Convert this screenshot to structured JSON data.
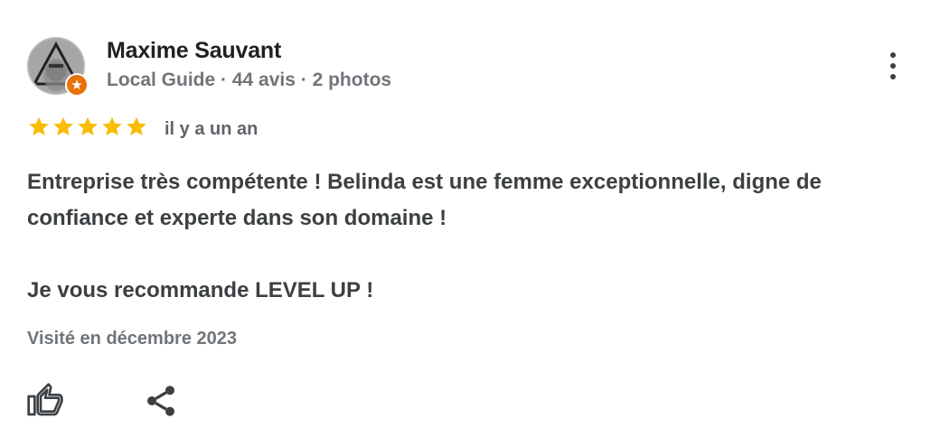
{
  "author": {
    "name": "Maxime Sauvant",
    "meta": "Local Guide · 44 avis · 2 photos",
    "avatar_icon": "user-photo-avatar",
    "badge_icon": "local-guide-star-badge",
    "badge_color": "#e8710a"
  },
  "review": {
    "rating": 5,
    "rating_max": 5,
    "star_color": "#fbbc04",
    "time": "il y a un an",
    "text_paragraphs": [
      "Entreprise très compétente ! Belinda est une femme exceptionnelle, digne de confiance et experte dans son domaine !",
      "Je vous recommande LEVEL UP !"
    ],
    "visited": "Visité en décembre 2023"
  },
  "actions": {
    "like_icon": "thumb-up-icon",
    "share_icon": "share-icon",
    "more_icon": "more-vert-icon"
  }
}
